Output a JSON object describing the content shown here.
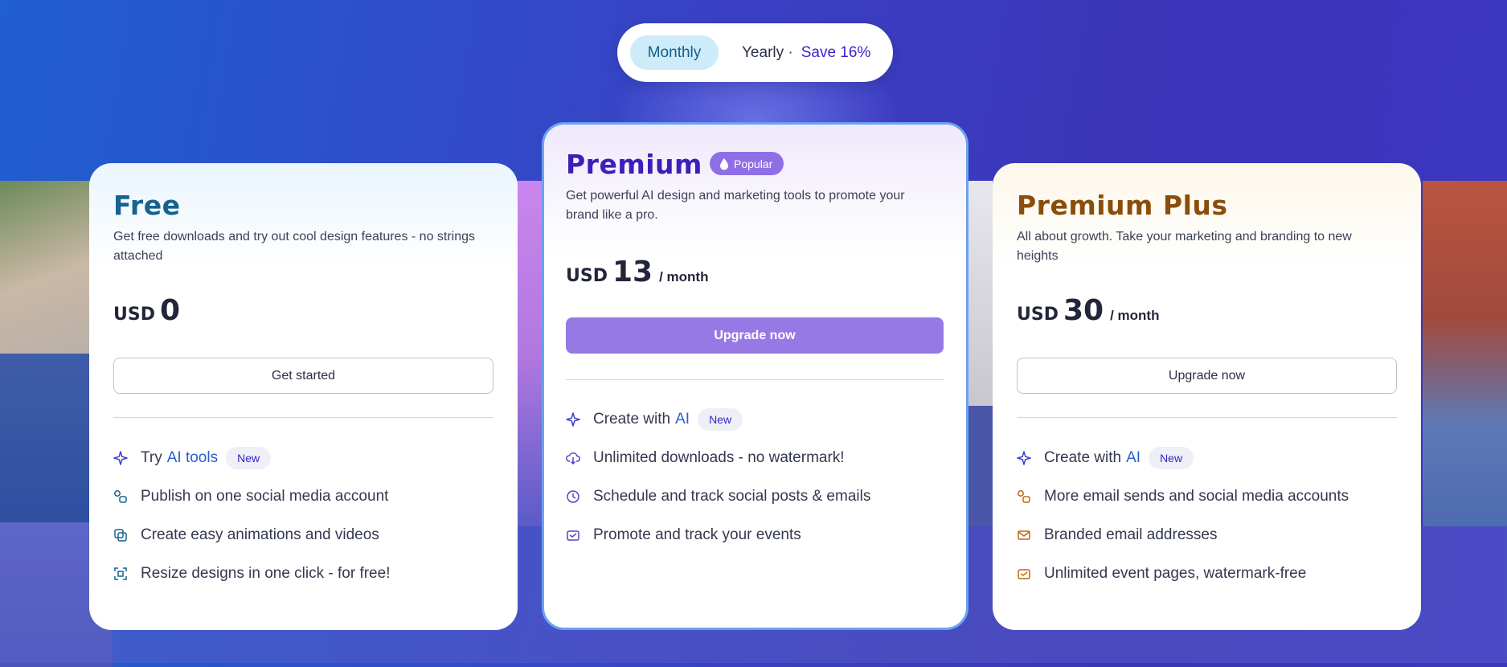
{
  "billing_toggle": {
    "monthly_label": "Monthly",
    "yearly_label": "Yearly ·",
    "save_label": "Save 16%",
    "selected": "Monthly"
  },
  "plans": {
    "free": {
      "title": "Free",
      "description": "Get free downloads and try out cool design features - no strings attached",
      "currency": "USD",
      "amount": "0",
      "period": "",
      "button_label": "Get started",
      "features": [
        {
          "icon": "sparkle-icon",
          "prefix": "Try",
          "highlight": "AI tools",
          "new_label": "New"
        },
        {
          "icon": "share-icon",
          "text": "Publish on one social media account"
        },
        {
          "icon": "animation-icon",
          "text": "Create easy animations and videos"
        },
        {
          "icon": "resize-icon",
          "text": "Resize designs in one click - for free!"
        }
      ]
    },
    "premium": {
      "title": "Premium",
      "badge_label": "Popular",
      "description": "Get powerful AI design and marketing tools to promote your brand like a pro.",
      "currency": "USD",
      "amount": "13",
      "period": "/ month",
      "button_label": "Upgrade now",
      "features": [
        {
          "icon": "sparkle-icon",
          "prefix": "Create with",
          "highlight": "AI",
          "new_label": "New"
        },
        {
          "icon": "cloud-download-icon",
          "text": "Unlimited downloads - no watermark!"
        },
        {
          "icon": "clock-icon",
          "text": "Schedule and track social posts & emails"
        },
        {
          "icon": "event-icon",
          "text": "Promote and track your events"
        }
      ]
    },
    "premium_plus": {
      "title": "Premium Plus",
      "description": "All about growth. Take your marketing and branding to new heights",
      "currency": "USD",
      "amount": "30",
      "period": "/ month",
      "button_label": "Upgrade now",
      "features": [
        {
          "icon": "sparkle-icon",
          "prefix": "Create with",
          "highlight": "AI",
          "new_label": "New"
        },
        {
          "icon": "share-icon",
          "text": "More email sends and social media accounts"
        },
        {
          "icon": "mail-icon",
          "text": "Branded email addresses"
        },
        {
          "icon": "event-icon",
          "text": "Unlimited event pages, watermark-free"
        }
      ]
    }
  },
  "colors": {
    "free_accent": "#14628f",
    "premium_accent": "#3a1fb8",
    "plus_accent": "#8a4d0a",
    "premium_button": "#9679e4",
    "link_blue": "#2b5fd0"
  }
}
